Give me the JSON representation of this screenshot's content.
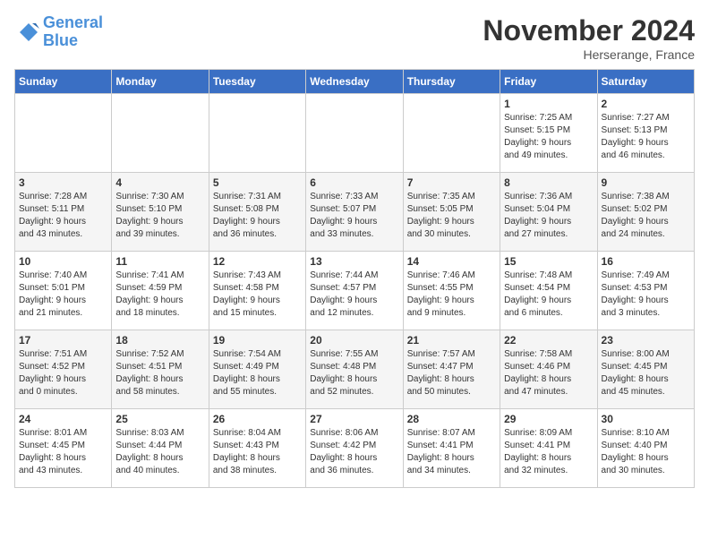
{
  "header": {
    "logo_line1": "General",
    "logo_line2": "Blue",
    "month_title": "November 2024",
    "location": "Herserange, France"
  },
  "days_of_week": [
    "Sunday",
    "Monday",
    "Tuesday",
    "Wednesday",
    "Thursday",
    "Friday",
    "Saturday"
  ],
  "weeks": [
    [
      {
        "day": "",
        "content": ""
      },
      {
        "day": "",
        "content": ""
      },
      {
        "day": "",
        "content": ""
      },
      {
        "day": "",
        "content": ""
      },
      {
        "day": "",
        "content": ""
      },
      {
        "day": "1",
        "content": "Sunrise: 7:25 AM\nSunset: 5:15 PM\nDaylight: 9 hours\nand 49 minutes."
      },
      {
        "day": "2",
        "content": "Sunrise: 7:27 AM\nSunset: 5:13 PM\nDaylight: 9 hours\nand 46 minutes."
      }
    ],
    [
      {
        "day": "3",
        "content": "Sunrise: 7:28 AM\nSunset: 5:11 PM\nDaylight: 9 hours\nand 43 minutes."
      },
      {
        "day": "4",
        "content": "Sunrise: 7:30 AM\nSunset: 5:10 PM\nDaylight: 9 hours\nand 39 minutes."
      },
      {
        "day": "5",
        "content": "Sunrise: 7:31 AM\nSunset: 5:08 PM\nDaylight: 9 hours\nand 36 minutes."
      },
      {
        "day": "6",
        "content": "Sunrise: 7:33 AM\nSunset: 5:07 PM\nDaylight: 9 hours\nand 33 minutes."
      },
      {
        "day": "7",
        "content": "Sunrise: 7:35 AM\nSunset: 5:05 PM\nDaylight: 9 hours\nand 30 minutes."
      },
      {
        "day": "8",
        "content": "Sunrise: 7:36 AM\nSunset: 5:04 PM\nDaylight: 9 hours\nand 27 minutes."
      },
      {
        "day": "9",
        "content": "Sunrise: 7:38 AM\nSunset: 5:02 PM\nDaylight: 9 hours\nand 24 minutes."
      }
    ],
    [
      {
        "day": "10",
        "content": "Sunrise: 7:40 AM\nSunset: 5:01 PM\nDaylight: 9 hours\nand 21 minutes."
      },
      {
        "day": "11",
        "content": "Sunrise: 7:41 AM\nSunset: 4:59 PM\nDaylight: 9 hours\nand 18 minutes."
      },
      {
        "day": "12",
        "content": "Sunrise: 7:43 AM\nSunset: 4:58 PM\nDaylight: 9 hours\nand 15 minutes."
      },
      {
        "day": "13",
        "content": "Sunrise: 7:44 AM\nSunset: 4:57 PM\nDaylight: 9 hours\nand 12 minutes."
      },
      {
        "day": "14",
        "content": "Sunrise: 7:46 AM\nSunset: 4:55 PM\nDaylight: 9 hours\nand 9 minutes."
      },
      {
        "day": "15",
        "content": "Sunrise: 7:48 AM\nSunset: 4:54 PM\nDaylight: 9 hours\nand 6 minutes."
      },
      {
        "day": "16",
        "content": "Sunrise: 7:49 AM\nSunset: 4:53 PM\nDaylight: 9 hours\nand 3 minutes."
      }
    ],
    [
      {
        "day": "17",
        "content": "Sunrise: 7:51 AM\nSunset: 4:52 PM\nDaylight: 9 hours\nand 0 minutes."
      },
      {
        "day": "18",
        "content": "Sunrise: 7:52 AM\nSunset: 4:51 PM\nDaylight: 8 hours\nand 58 minutes."
      },
      {
        "day": "19",
        "content": "Sunrise: 7:54 AM\nSunset: 4:49 PM\nDaylight: 8 hours\nand 55 minutes."
      },
      {
        "day": "20",
        "content": "Sunrise: 7:55 AM\nSunset: 4:48 PM\nDaylight: 8 hours\nand 52 minutes."
      },
      {
        "day": "21",
        "content": "Sunrise: 7:57 AM\nSunset: 4:47 PM\nDaylight: 8 hours\nand 50 minutes."
      },
      {
        "day": "22",
        "content": "Sunrise: 7:58 AM\nSunset: 4:46 PM\nDaylight: 8 hours\nand 47 minutes."
      },
      {
        "day": "23",
        "content": "Sunrise: 8:00 AM\nSunset: 4:45 PM\nDaylight: 8 hours\nand 45 minutes."
      }
    ],
    [
      {
        "day": "24",
        "content": "Sunrise: 8:01 AM\nSunset: 4:45 PM\nDaylight: 8 hours\nand 43 minutes."
      },
      {
        "day": "25",
        "content": "Sunrise: 8:03 AM\nSunset: 4:44 PM\nDaylight: 8 hours\nand 40 minutes."
      },
      {
        "day": "26",
        "content": "Sunrise: 8:04 AM\nSunset: 4:43 PM\nDaylight: 8 hours\nand 38 minutes."
      },
      {
        "day": "27",
        "content": "Sunrise: 8:06 AM\nSunset: 4:42 PM\nDaylight: 8 hours\nand 36 minutes."
      },
      {
        "day": "28",
        "content": "Sunrise: 8:07 AM\nSunset: 4:41 PM\nDaylight: 8 hours\nand 34 minutes."
      },
      {
        "day": "29",
        "content": "Sunrise: 8:09 AM\nSunset: 4:41 PM\nDaylight: 8 hours\nand 32 minutes."
      },
      {
        "day": "30",
        "content": "Sunrise: 8:10 AM\nSunset: 4:40 PM\nDaylight: 8 hours\nand 30 minutes."
      }
    ]
  ]
}
